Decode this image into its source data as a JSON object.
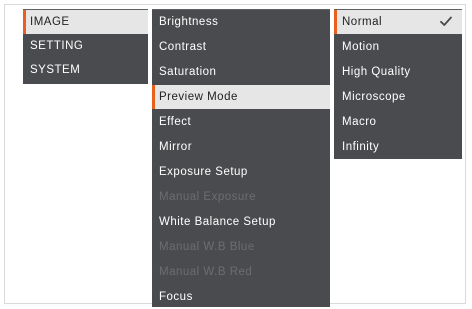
{
  "colors": {
    "panel_bg": "#4a4b4e",
    "selected_bg": "#e6e6e6",
    "accent": "#e8601c",
    "disabled_text": "#6c6d70"
  },
  "main_menu": {
    "items": [
      {
        "label": "IMAGE",
        "selected": true
      },
      {
        "label": "SETTING",
        "selected": false
      },
      {
        "label": "SYSTEM",
        "selected": false
      }
    ]
  },
  "image_menu": {
    "items": [
      {
        "label": "Brightness",
        "state": "normal"
      },
      {
        "label": "Contrast",
        "state": "normal"
      },
      {
        "label": "Saturation",
        "state": "normal"
      },
      {
        "label": "Preview Mode",
        "state": "selected"
      },
      {
        "label": "Effect",
        "state": "normal"
      },
      {
        "label": "Mirror",
        "state": "normal"
      },
      {
        "label": "Exposure Setup",
        "state": "normal"
      },
      {
        "label": "Manual Exposure",
        "state": "disabled"
      },
      {
        "label": "White Balance Setup",
        "state": "normal"
      },
      {
        "label": "Manual W.B Blue",
        "state": "disabled"
      },
      {
        "label": "Manual W.B Red",
        "state": "disabled"
      },
      {
        "label": "Focus",
        "state": "normal"
      }
    ]
  },
  "preview_mode_menu": {
    "items": [
      {
        "label": "Normal",
        "selected": true,
        "checked_icon": "checkmark-icon"
      },
      {
        "label": "Motion",
        "selected": false
      },
      {
        "label": "High Quality",
        "selected": false
      },
      {
        "label": "Microscope",
        "selected": false
      },
      {
        "label": "Macro",
        "selected": false
      },
      {
        "label": "Infinity",
        "selected": false
      }
    ]
  }
}
